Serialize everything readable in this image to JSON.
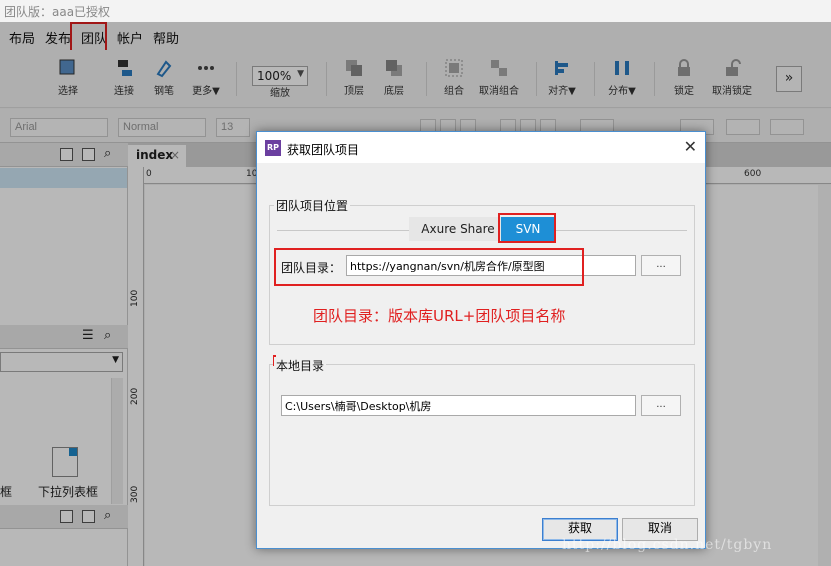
{
  "app": {
    "title": "团队版：aaa已授权",
    "menu": [
      "布局",
      "发布",
      "团队",
      "帐户",
      "帮助"
    ]
  },
  "toolbar": {
    "tools": [
      "选择",
      "连接",
      "钢笔",
      "更多▼",
      "缩放",
      "顶层",
      "底层",
      "组合",
      "取消组合",
      "对齐▼",
      "分布▼",
      "锁定",
      "取消锁定"
    ],
    "zoom_value": "100%"
  },
  "formatbar": {
    "font_family": "Arial",
    "font_weight": "Normal",
    "font_size": "13"
  },
  "page_tab": {
    "label": "index",
    "close": "×"
  },
  "ruler": {
    "h": [
      "0",
      "10",
      "600"
    ],
    "v": [
      "100",
      "200",
      "300"
    ]
  },
  "library": {
    "item_labels": [
      "框",
      "下拉列表框"
    ]
  },
  "dialog": {
    "title": "获取团队项目",
    "team_group_label": "团队项目位置",
    "tabs": [
      "Axure Share",
      "SVN"
    ],
    "active_tab": "SVN",
    "team_dir_label": "团队目录：",
    "team_dir_value": "https://yangnan/svn/机房合作/原型图",
    "browse_label": "...",
    "annotation": "团队目录：版本库URL+团队项目名称",
    "local_group_label": "本地目录",
    "local_dir_value": "C:\\Users\\楠哥\\Desktop\\机房",
    "ok_label": "获取",
    "cancel_label": "取消"
  },
  "watermark": "http://blog.csdn.net/tgbyn",
  "colors": {
    "accent": "#1e8fd6",
    "annotation_red": "#e02020"
  }
}
